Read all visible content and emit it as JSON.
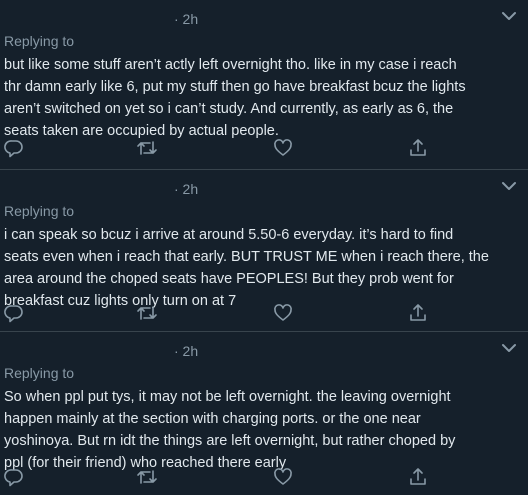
{
  "tweets": [
    {
      "time": "· 2h",
      "replying": "Replying to",
      "lines": [
        "but like some stuff aren’t actly left overnight tho. like in my case i reach",
        "thr damn early like 6, put my stuff then go have breakfast bcuz the lights",
        "aren’t switched on yet so i can’t study. And currently, as early as 6, the",
        "seats taken are occupied by actual people."
      ]
    },
    {
      "time": "· 2h",
      "replying": "Replying to",
      "lines": [
        "i can speak so bcuz i arrive at around 5.50-6 everyday. it’s hard to find",
        "seats even when i reach that early. BUT TRUST ME when i reach there, the",
        "area around the choped seats have PEOPLES! But they prob went for",
        "breakfast cuz lights only turn on at 7"
      ]
    },
    {
      "time": "· 2h",
      "replying": "Replying to",
      "lines": [
        "So when ppl put tys, it may not be left overnight. the leaving overnight",
        "happen mainly at the section with charging ports. or the one near",
        "yoshinoya. But rn idt the things are left overnight, but rather choped by",
        "ppl (for their friend) who reached there early"
      ]
    }
  ],
  "icons": {
    "more": "chevron-down-icon",
    "reply": "reply-icon",
    "retweet": "retweet-icon",
    "like": "heart-icon",
    "share": "share-icon"
  },
  "colors": {
    "background": "#15202b",
    "divider": "#38444d",
    "text": "#e1e8ed",
    "muted": "#8899a6"
  }
}
